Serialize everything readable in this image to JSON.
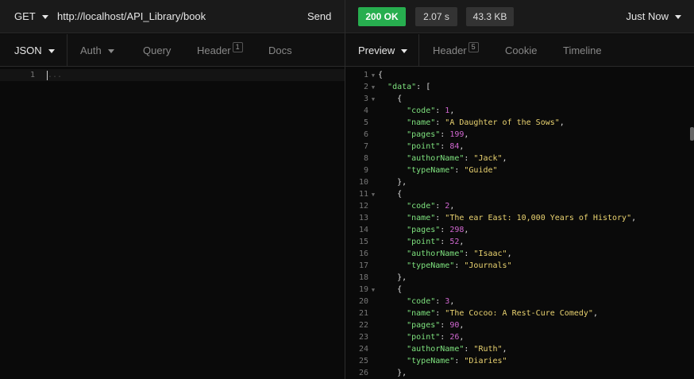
{
  "request": {
    "method": "GET",
    "url": "http://localhost/API_Library/book",
    "send_label": "Send"
  },
  "response": {
    "status": "200 OK",
    "time": "2.07 s",
    "size": "43.3 KB",
    "history": "Just Now"
  },
  "left_tabs": [
    {
      "label": "JSON"
    },
    {
      "label": "Auth"
    },
    {
      "label": "Query"
    },
    {
      "label": "Header",
      "count": "1"
    },
    {
      "label": "Docs"
    }
  ],
  "right_tabs": [
    {
      "label": "Preview"
    },
    {
      "label": "Header",
      "count": "5"
    },
    {
      "label": "Cookie"
    },
    {
      "label": "Timeline"
    }
  ],
  "editor": {
    "line_number": "1",
    "placeholder": "..."
  },
  "books": [
    {
      "code": "1",
      "name": "A Daughter of the Sows",
      "pages": "199",
      "point": "84",
      "authorName": "Jack",
      "typeName": "Guide"
    },
    {
      "code": "2",
      "name": "The ear East: 10,000 Years of History",
      "pages": "298",
      "point": "52",
      "authorName": "Isaac",
      "typeName": "Journals"
    },
    {
      "code": "3",
      "name": "The Cocoo: A Rest-Cure Comedy",
      "pages": "90",
      "point": "26",
      "authorName": "Ruth",
      "typeName": "Diaries"
    }
  ],
  "colors": {
    "status_ok": "#27ae4f",
    "json_key": "#7ee27e",
    "json_string": "#ead370",
    "json_number": "#d067d0"
  }
}
